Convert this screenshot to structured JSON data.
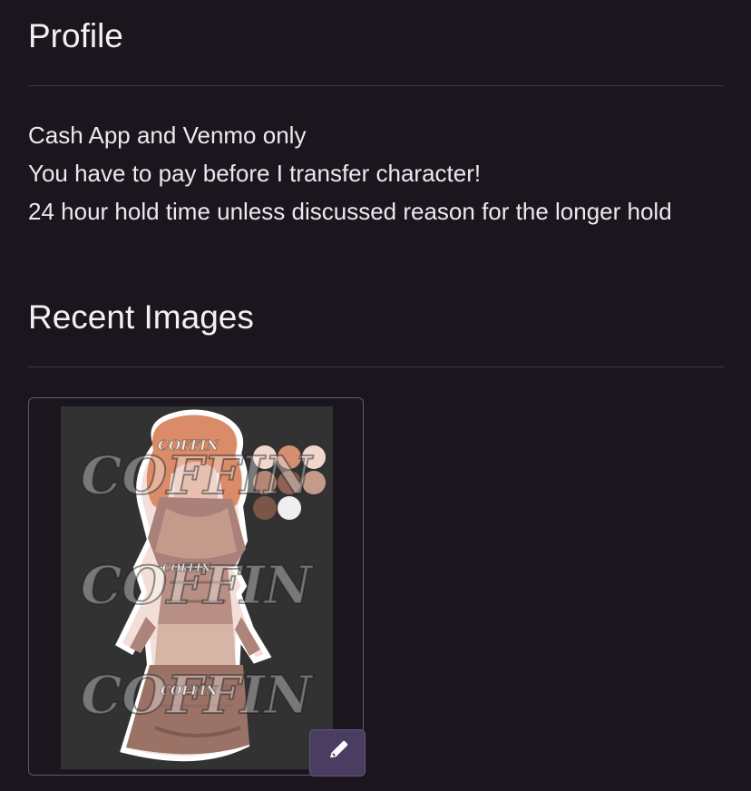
{
  "profile": {
    "title": "Profile",
    "lines": [
      "Cash App and Venmo only",
      "You have to pay before I transfer character!",
      "24 hour hold time unless discussed reason for the longer hold"
    ]
  },
  "recent_images": {
    "title": "Recent Images",
    "watermark_text": "COFFIN",
    "palette_colors": [
      "#f0d7cc",
      "#d48f73",
      "#f0d7cc",
      "#b48876",
      "#8f6152",
      "#c49a8b",
      "#7a5646",
      "#8f6152",
      "#efefef"
    ]
  },
  "icons": {
    "edit": "pencil-icon"
  },
  "colors": {
    "background": "#1b161d",
    "accent": "#4a3d61",
    "border": "#5f5872"
  }
}
